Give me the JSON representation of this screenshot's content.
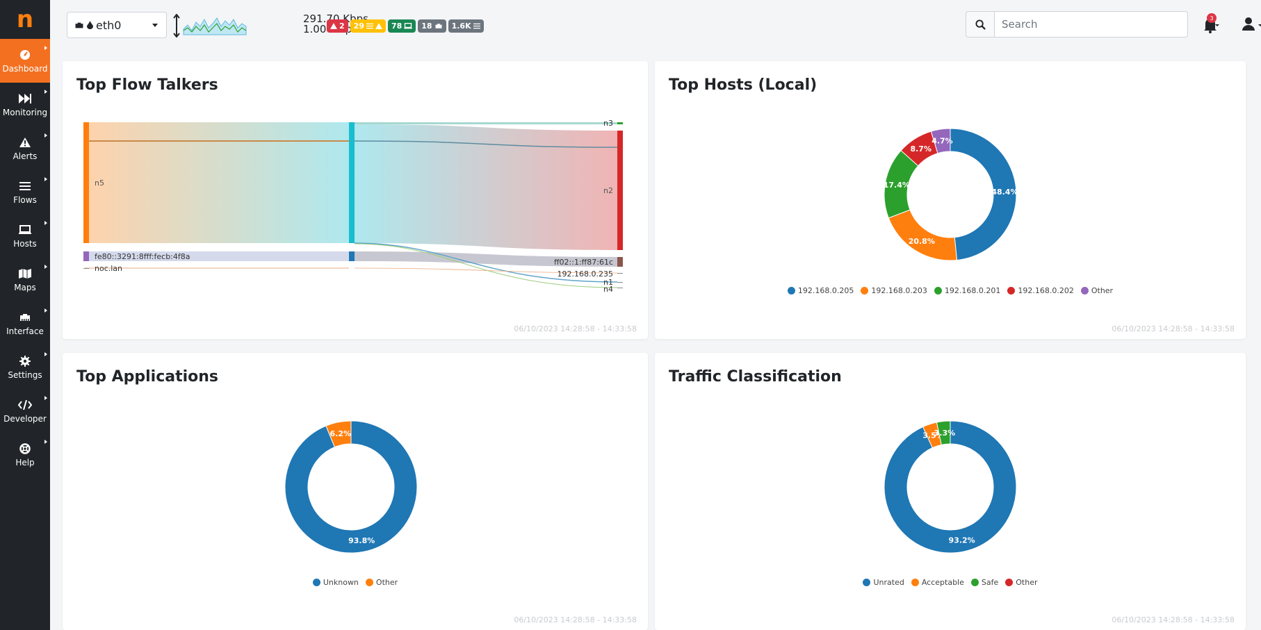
{
  "sidebar": {
    "logo": "n",
    "items": [
      {
        "label": "Dashboard",
        "icon": "dashboard-icon",
        "active": true
      },
      {
        "label": "Monitoring",
        "icon": "fast-forward-icon"
      },
      {
        "label": "Alerts",
        "icon": "warning-icon"
      },
      {
        "label": "Flows",
        "icon": "list-icon"
      },
      {
        "label": "Hosts",
        "icon": "laptop-icon"
      },
      {
        "label": "Maps",
        "icon": "map-icon"
      },
      {
        "label": "Interface",
        "icon": "ethernet-icon"
      },
      {
        "label": "Settings",
        "icon": "gear-icon"
      },
      {
        "label": "Developer",
        "icon": "code-icon"
      },
      {
        "label": "Help",
        "icon": "lifebuoy-icon"
      }
    ]
  },
  "topbar": {
    "interface": "eth0",
    "throughput_up": "291.70 Kbps",
    "throughput_down": "1.00 Mbps",
    "badges": [
      {
        "text": "2",
        "color": "#dc3545",
        "icon": "warning-icon"
      },
      {
        "text": "29",
        "color": "#ffc107",
        "icon": "list-warning-icon"
      },
      {
        "text": "78",
        "color": "#198754",
        "icon": "laptop-icon"
      },
      {
        "text": "18",
        "color": "#6c757d",
        "icon": "ethernet-icon"
      },
      {
        "text": "1.6K",
        "color": "#6c757d",
        "icon": "list-icon"
      }
    ],
    "search_placeholder": "Search",
    "notification_count": "3"
  },
  "cards": {
    "flow_talkers": {
      "title": "Top Flow Talkers",
      "timestamp": "06/10/2023 14:28:58 - 14:33:58"
    },
    "top_hosts": {
      "title": "Top Hosts (Local)",
      "timestamp": "06/10/2023 14:28:58 - 14:33:58"
    },
    "top_apps": {
      "title": "Top Applications",
      "timestamp": "06/10/2023 14:28:58 - 14:33:58"
    },
    "traffic_class": {
      "title": "Traffic Classification",
      "timestamp": "06/10/2023 14:28:58 - 14:33:58"
    }
  },
  "chart_data": [
    {
      "type": "sankey",
      "title": "Top Flow Talkers",
      "sources": [
        "n5",
        "fe80::3291:8fff:fecb:4f8a",
        "noc.lan"
      ],
      "targets": [
        "n3",
        "n2",
        "ff02::1:ff87:61c",
        "192.168.0.235",
        "n1",
        "n4"
      ]
    },
    {
      "type": "pie",
      "title": "Top Hosts (Local)",
      "labels": [
        "192.168.0.205",
        "192.168.0.203",
        "192.168.0.201",
        "192.168.0.202",
        "Other"
      ],
      "values": [
        48.4,
        20.8,
        17.4,
        8.7,
        4.7
      ],
      "value_labels": [
        "48.4%",
        "20.8%",
        "17.4%",
        "8.7%",
        "4.7%"
      ],
      "colors": [
        "#1f77b4",
        "#ff7f0e",
        "#2ca02c",
        "#d62728",
        "#9467bd"
      ]
    },
    {
      "type": "pie",
      "title": "Top Applications",
      "labels": [
        "Unknown",
        "Other"
      ],
      "values": [
        93.8,
        6.2
      ],
      "value_labels": [
        "93.8%",
        "6.2%"
      ],
      "colors": [
        "#1f77b4",
        "#ff7f0e"
      ]
    },
    {
      "type": "pie",
      "title": "Traffic Classification",
      "labels": [
        "Unrated",
        "Acceptable",
        "Safe",
        "Other"
      ],
      "values": [
        93.2,
        3.5,
        3.3,
        0
      ],
      "value_labels": [
        "93.2%",
        "3.5%",
        "3.3%",
        ""
      ],
      "colors": [
        "#1f77b4",
        "#ff7f0e",
        "#2ca02c",
        "#d62728"
      ]
    }
  ]
}
